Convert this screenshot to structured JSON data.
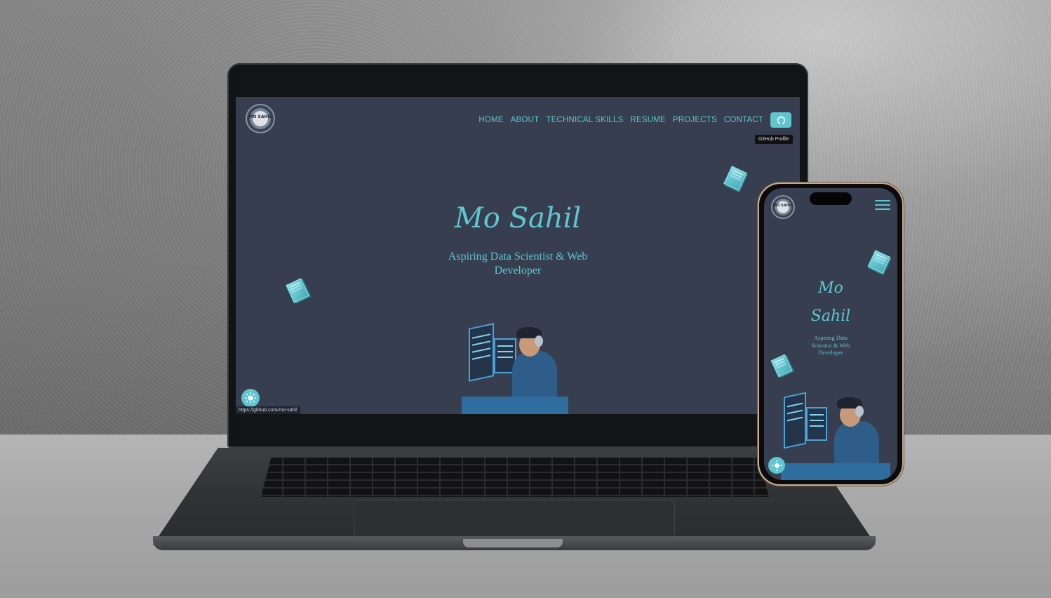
{
  "site": {
    "logo_text": "MO SAHIL",
    "nav": [
      "HOME",
      "ABOUT",
      "TECHNICAL SKILLS",
      "RESUME",
      "PROJECTS",
      "CONTACT"
    ],
    "github_tooltip": "GitHub Profile",
    "name": "Mo Sahil",
    "name_line1": "Mo",
    "name_line2": "Sahil",
    "subtitle": "Aspiring Data Scientist & Web Developer",
    "subtitle_line1": "Aspiring Data Scientist & Web",
    "subtitle_line2": "Developer",
    "mobile_sub_1": "Aspiring Data",
    "mobile_sub_2": "Scientist & Web",
    "mobile_sub_3": "Developer",
    "status_url": "https://github.com/mo-sahil"
  },
  "icons": {
    "github": "github-icon",
    "theme": "sun-icon",
    "menu": "hamburger-menu-icon"
  },
  "colors": {
    "background": "#363e4f",
    "accent": "#5fc6cf"
  }
}
